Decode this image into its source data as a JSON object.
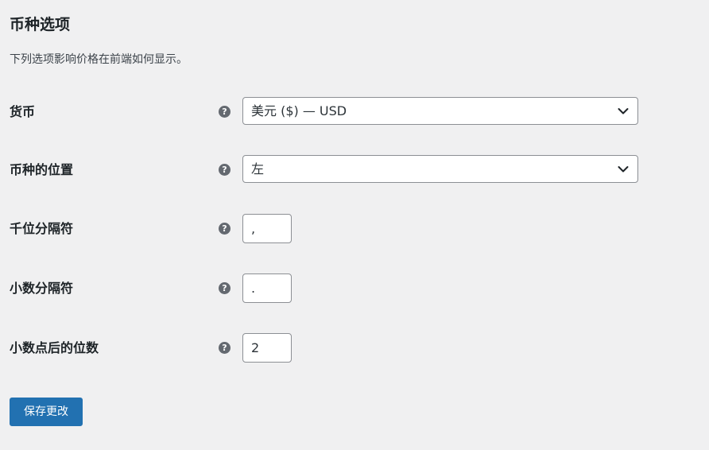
{
  "section": {
    "title": "币种选项",
    "description": "下列选项影响价格在前端如何显示。"
  },
  "fields": {
    "currency": {
      "label": "货币",
      "help_icon": "?",
      "value": "美元 ($) — USD"
    },
    "currency_position": {
      "label": "币种的位置",
      "help_icon": "?",
      "value": "左"
    },
    "thousand_separator": {
      "label": "千位分隔符",
      "help_icon": "?",
      "value": ","
    },
    "decimal_separator": {
      "label": "小数分隔符",
      "help_icon": "?",
      "value": "."
    },
    "num_decimals": {
      "label": "小数点后的位数",
      "help_icon": "?",
      "value": "2"
    }
  },
  "actions": {
    "save_label": "保存更改"
  },
  "colors": {
    "background": "#f0f0f1",
    "primary_button": "#2271b1",
    "help_icon": "#646970",
    "input_border": "#8c8f94"
  },
  "icons": {
    "help": "question-circle-icon",
    "dropdown": "chevron-down-icon"
  }
}
